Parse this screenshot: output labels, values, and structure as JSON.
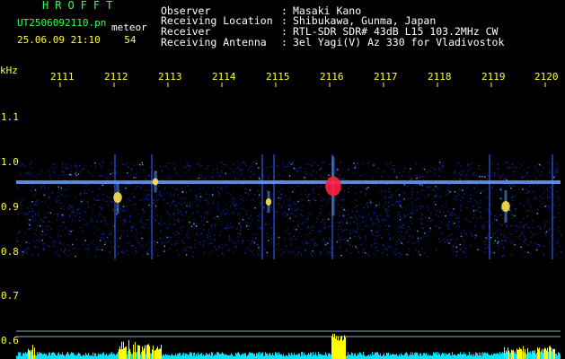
{
  "header": {
    "brand": "HROFFT",
    "file_name": "UT2506092110.pn",
    "type_label": "meteor",
    "date_time": "25.06.09 21:10",
    "count": "54"
  },
  "meta": [
    {
      "label": "Observer",
      "value": "Masaki Kano"
    },
    {
      "label": "Receiving Location",
      "value": "Shibukawa, Gunma, Japan"
    },
    {
      "label": "Receiver",
      "value": "RTL-SDR SDR# 43dB L15 103.2MHz CW"
    },
    {
      "label": "Receiving Antenna",
      "value": "3el Yagi(V) Az 330 for Vladivostok"
    }
  ],
  "separator": ":",
  "axes": {
    "y_unit": "kHz",
    "x_ticks": [
      "2111",
      "2112",
      "2113",
      "2114",
      "2115",
      "2116",
      "2117",
      "2118",
      "2119",
      "2120"
    ],
    "y_ticks": [
      "1.1",
      "1.0",
      "0.9",
      "0.8",
      "0.7",
      "0.6"
    ]
  },
  "colors": {
    "text_green": "#33ff55",
    "text_yellow": "#ffff33",
    "text_white": "#ffffff",
    "background": "#000000",
    "noise_blue": "#1a2fd6",
    "carrier": "#6aa0ff",
    "echo_hot": "#ff2040",
    "level_cyan": "#00e5ff",
    "level_yellow": "#ffff00"
  },
  "spectrogram": {
    "carrier_freq_khz": 0.955,
    "band_khz": [
      0.79,
      1.0
    ],
    "echoes": [
      {
        "time_min": 2112.2,
        "freq_khz": 0.92,
        "strength": "medium"
      },
      {
        "time_min": 2112.9,
        "freq_khz": 0.955,
        "strength": "weak"
      },
      {
        "time_min": 2115.0,
        "freq_khz": 0.91,
        "strength": "weak"
      },
      {
        "time_min": 2116.2,
        "freq_khz": 0.945,
        "strength": "strong"
      },
      {
        "time_min": 2119.4,
        "freq_khz": 0.9,
        "strength": "medium"
      }
    ]
  }
}
